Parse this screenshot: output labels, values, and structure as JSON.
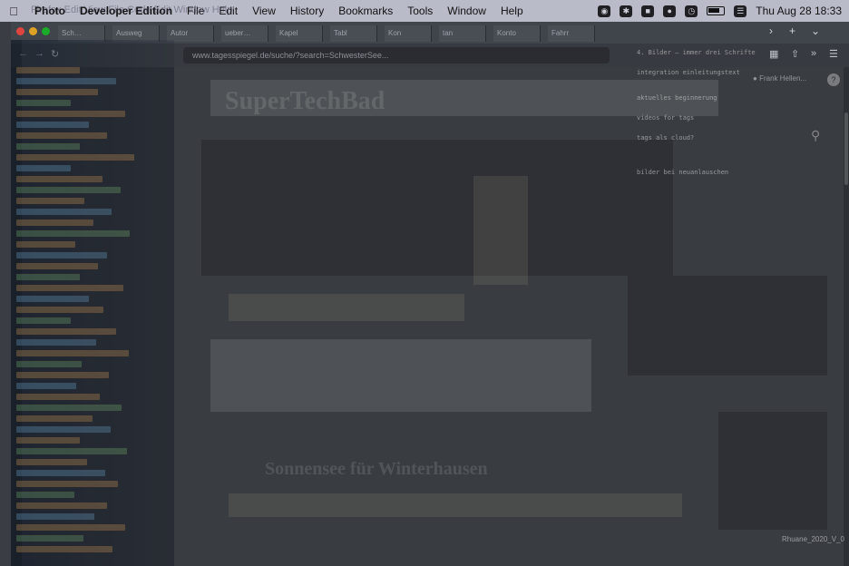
{
  "menubar": {
    "apple_icon": "apple-logo-icon",
    "items": [
      {
        "label": "Photo"
      },
      {
        "label": "Developer Edition"
      },
      {
        "label": "File"
      },
      {
        "label": "Edit"
      },
      {
        "label": "View"
      },
      {
        "label": "History"
      },
      {
        "label": "Bookmarks"
      },
      {
        "label": "Tools"
      },
      {
        "label": "Window"
      },
      {
        "label": "Help"
      }
    ],
    "ghost_text": "Firefox  Edit  View  File  Code  Edit  Window  Help",
    "status_icons": [
      "ai-assistant-icon",
      "bluetooth-icon",
      "clipboard-icon",
      "record-icon",
      "time-machine-icon"
    ],
    "clock": "Thu Aug 28  18:33"
  },
  "window": {
    "tabs": [
      {
        "label": "Sch…"
      },
      {
        "label": "Ausweg"
      },
      {
        "label": "Autor"
      },
      {
        "label": "ueber…"
      },
      {
        "label": "Kapel"
      },
      {
        "label": "Tabl"
      },
      {
        "label": "Kon"
      },
      {
        "label": "tan"
      },
      {
        "label": "Konto"
      },
      {
        "label": "Fahrr"
      }
    ],
    "url": "www.tagesspiegel.de/suche/?search=SchwesterSee...",
    "account_name": "Frank Hellen...",
    "help_label": "?",
    "notes": [
      {
        "text": "4. Bilder — immer drei Schrifte"
      },
      {
        "text": "integration einleitungstext"
      },
      {
        "text": "aktuelles beginnerung"
      },
      {
        "text": "videos for tags"
      },
      {
        "text": "tags als cloud?"
      },
      {
        "text": "bilder bei neuanlauschen"
      }
    ],
    "page_title_ghost": "SuperTechBad",
    "page_headline_ghost": "Sonnensee für Winterhausen",
    "footer_label": "Rhuane_2020_V_0"
  }
}
